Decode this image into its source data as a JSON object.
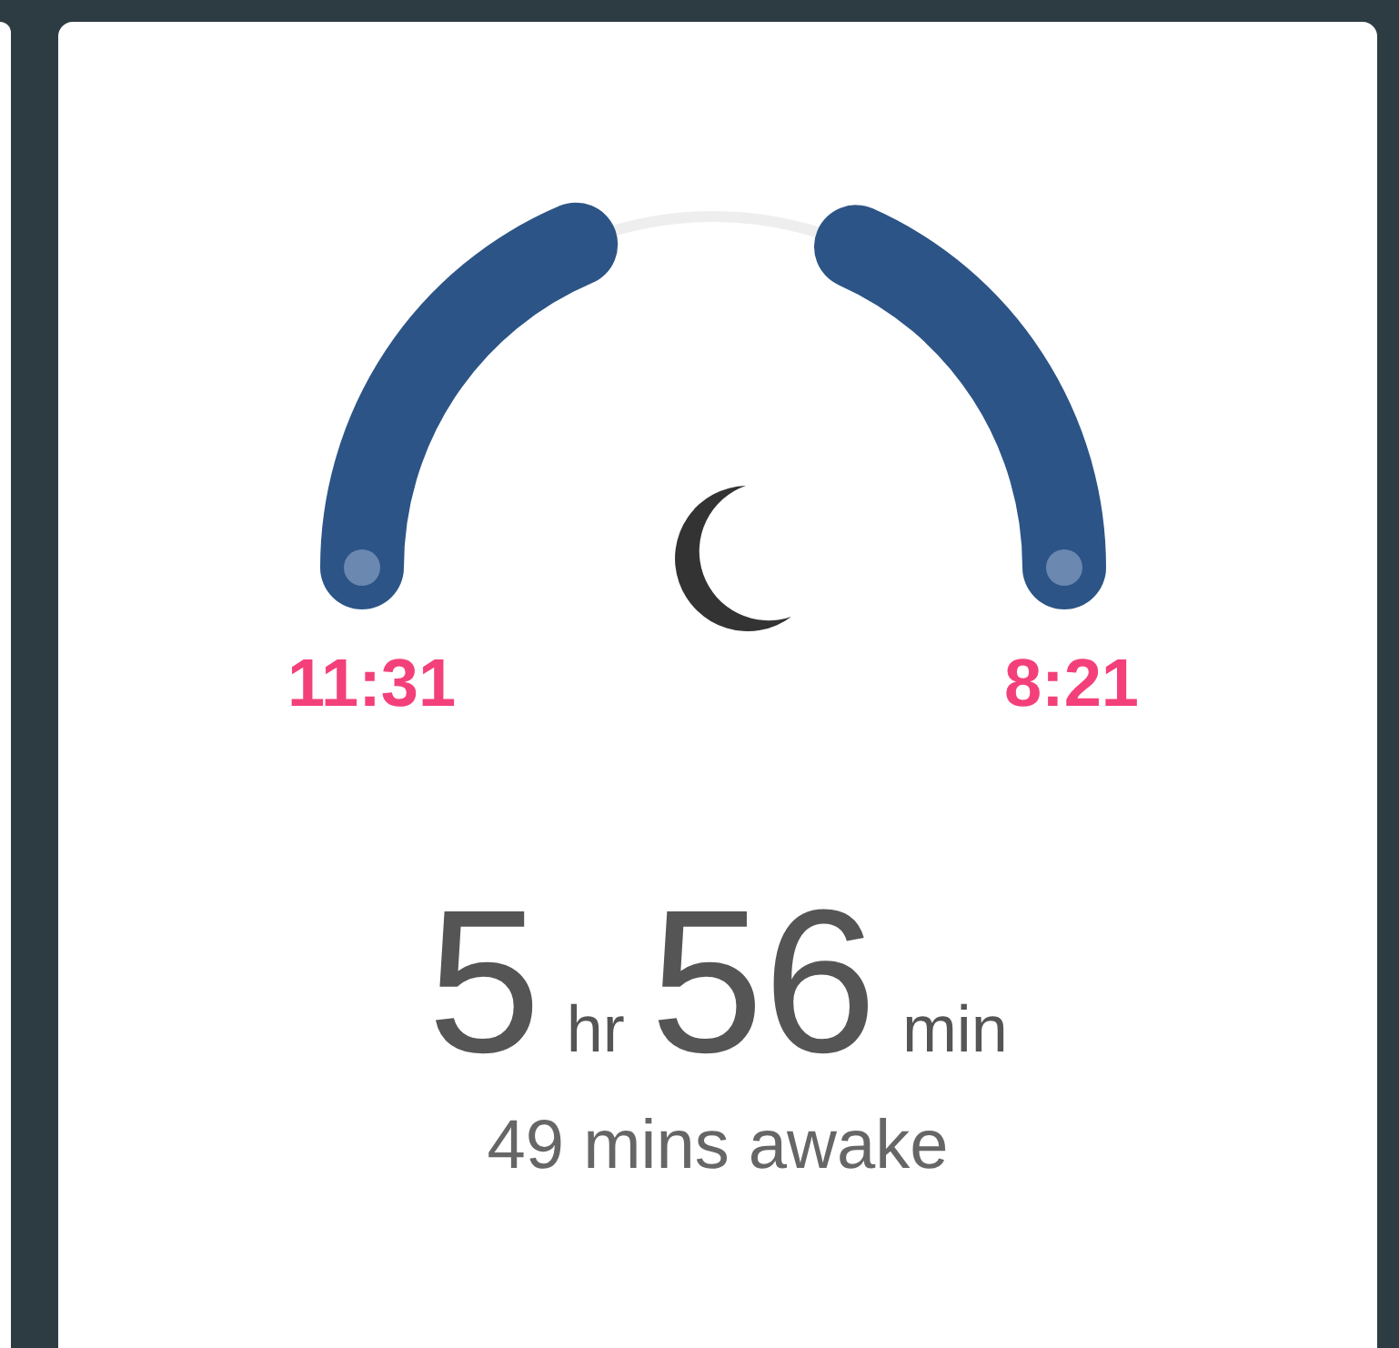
{
  "sleep": {
    "start_time": "11:31",
    "end_time": "8:21"
  },
  "duration": {
    "hours": "5",
    "hours_unit": "hr",
    "minutes": "56",
    "minutes_unit": "min"
  },
  "awake": "49 mins awake"
}
